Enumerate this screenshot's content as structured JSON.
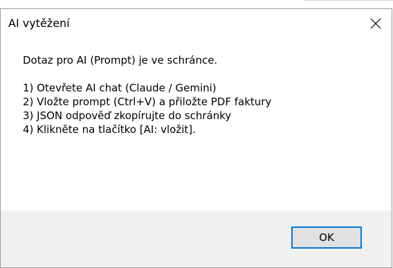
{
  "window": {
    "title": "AI vytěžení",
    "close_icon": "close-icon"
  },
  "message": {
    "lines": [
      "Dotaz pro AI (Prompt) je ve schránce.",
      "",
      "1) Otevřete AI chat (Claude / Gemini)",
      "2) Vložte prompt (Ctrl+V) a přiložte PDF faktury",
      "3) JSON odpověď zkopírujte do schránky",
      "4) Klikněte na tlačítko [AI: vložit]."
    ]
  },
  "buttons": {
    "ok_label": "OK"
  },
  "colors": {
    "focus_border": "#0078d7",
    "footer_background": "#f0f0f0",
    "button_face": "#e1e1e1"
  }
}
